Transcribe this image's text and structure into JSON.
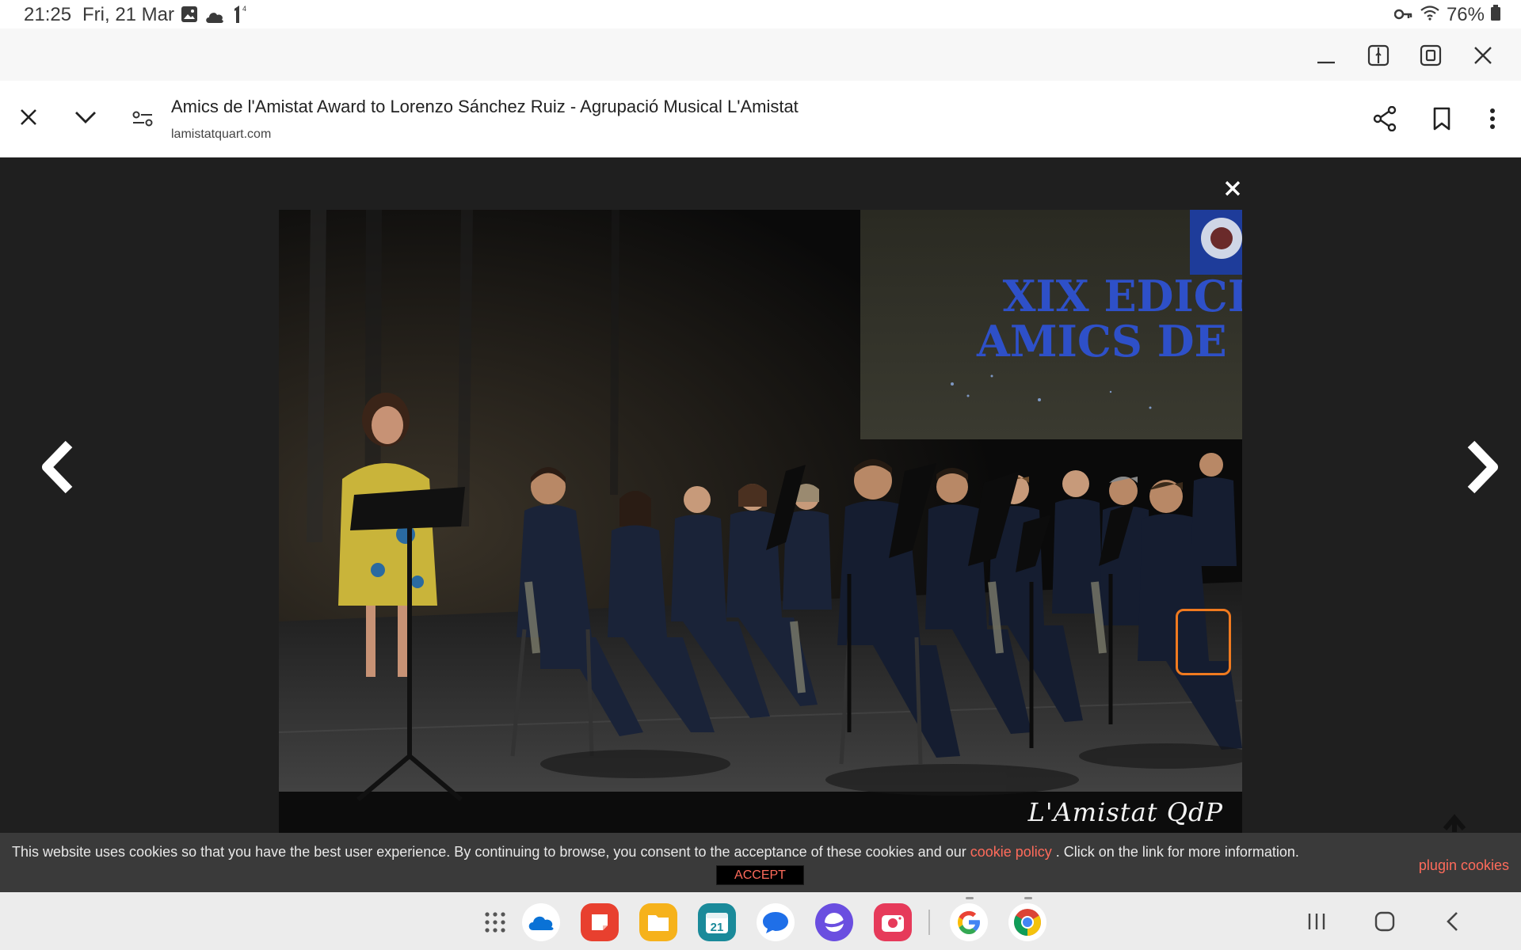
{
  "status_bar": {
    "time": "21:25",
    "date": "Fri, 21 Mar",
    "notif_icons": [
      "gallery-icon",
      "cloud-icon",
      "signal-icon"
    ],
    "battery": "76%"
  },
  "window_controls": [
    "minimize-icon",
    "split-screen-icon",
    "popup-view-icon",
    "close-window-icon"
  ],
  "toolbar": {
    "title": "Amics de l'Amistat Award to Lorenzo Sánchez Ruiz - Agrupació Musical L'Amistat",
    "url": "lamistatquart.com"
  },
  "photo": {
    "banner_line1": "XIX EDICIÓ",
    "banner_line2": "AMICS DE L'",
    "watermark": "L'Amistat QdP"
  },
  "cookie_bar": {
    "text_before": "This website uses cookies so that you have the best user experience. By continuing to browse, you consent to the acceptance of these cookies and our ",
    "link": "cookie policy",
    "text_after": " . Click on the link for more information.",
    "accept": "ACCEPT",
    "plugin": "plugin cookies"
  },
  "taskbar": {
    "apps": [
      "app-drawer",
      "onedrive",
      "keep-notes",
      "my-files",
      "calendar",
      "messages",
      "internet",
      "camera",
      "google",
      "chrome"
    ],
    "calendar_day": "21",
    "colors": {
      "onedrive": "#0a72d6",
      "notes": "#e8402f",
      "files": "#f6b21b",
      "calendar": "#1a8a9a",
      "messages": "#1f6fe8",
      "internet": "#6a4ee0",
      "camera": "#e63a5a"
    }
  },
  "colors": {
    "highlight": "#f07a1f",
    "link": "#ff6b5b"
  }
}
